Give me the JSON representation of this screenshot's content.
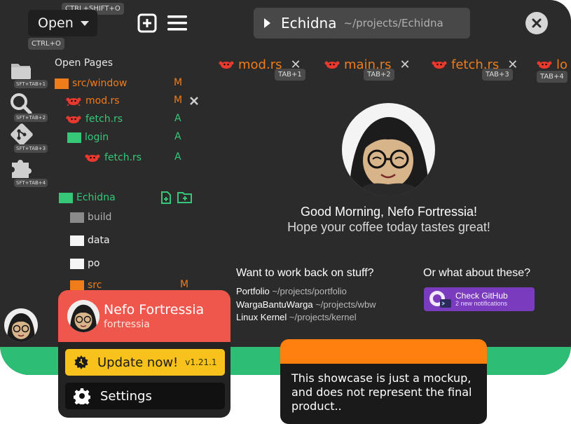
{
  "header": {
    "open_label": "Open",
    "open_shortcut": "CTRL+O",
    "new_shortcut": "CTRL+SHIFT+O",
    "project_name": "Echidna",
    "project_path": "~/projects/Echidna"
  },
  "activity_bar": [
    {
      "icon": "folder-icon",
      "shortcut": "SFT+TAB+1"
    },
    {
      "icon": "search-icon",
      "shortcut": "SFT+TAB+2"
    },
    {
      "icon": "git-icon",
      "shortcut": "SFT+TAB+3"
    },
    {
      "icon": "puzzle-icon",
      "shortcut": "SFT+TAB+4"
    }
  ],
  "open_pages": {
    "title": "Open Pages",
    "items": [
      {
        "label": "src/window",
        "status": "M"
      },
      {
        "label": "mod.rs",
        "status": "M"
      },
      {
        "label": "fetch.rs",
        "status": "A"
      },
      {
        "label": "login",
        "status": "A"
      },
      {
        "label": "fetch.rs",
        "status": "A"
      }
    ]
  },
  "explorer": {
    "root": "Echidna",
    "items": [
      {
        "label": "build",
        "status": ""
      },
      {
        "label": "data",
        "status": ""
      },
      {
        "label": "po",
        "status": ""
      },
      {
        "label": "src",
        "status": "M"
      }
    ]
  },
  "tabs": [
    {
      "label": "mod.rs",
      "shortcut": "TAB+1"
    },
    {
      "label": "main.rs",
      "shortcut": "TAB+2"
    },
    {
      "label": "fetch.rs",
      "shortcut": "TAB+3"
    },
    {
      "label": "lo",
      "shortcut": "TAB+4"
    }
  ],
  "welcome": {
    "greeting": "Good Morning, Nefo Fortressia!",
    "subgreeting": "Hope your coffee today tastes great!",
    "recent_title": "Want to work back on stuff?",
    "recent": [
      {
        "name": "Portfolio",
        "path": "~/projects/portfolio"
      },
      {
        "name": "WargaBantuWarga",
        "path": "~/projects/wbw"
      },
      {
        "name": "Linux Kernel",
        "path": "~/projects/kernel"
      }
    ],
    "other_title": "Or what about these?",
    "github_label": "Check GitHub",
    "github_sub": "2 new notifications"
  },
  "user": {
    "name": "Nefo Fortressia",
    "handle": "fortressia",
    "update_label": "Update now!",
    "version": "v1.21.1",
    "settings_label": "Settings"
  },
  "notice": {
    "text": "This showcase is just a mockup, and does not represent the final product.."
  },
  "colors": {
    "accent_orange": "#f07c1a",
    "accent_green": "#36c878",
    "window_bg": "#2b2b2b",
    "user_red": "#f0574c",
    "update_yellow": "#f7c21b",
    "github_purple": "#7a3bbf"
  }
}
